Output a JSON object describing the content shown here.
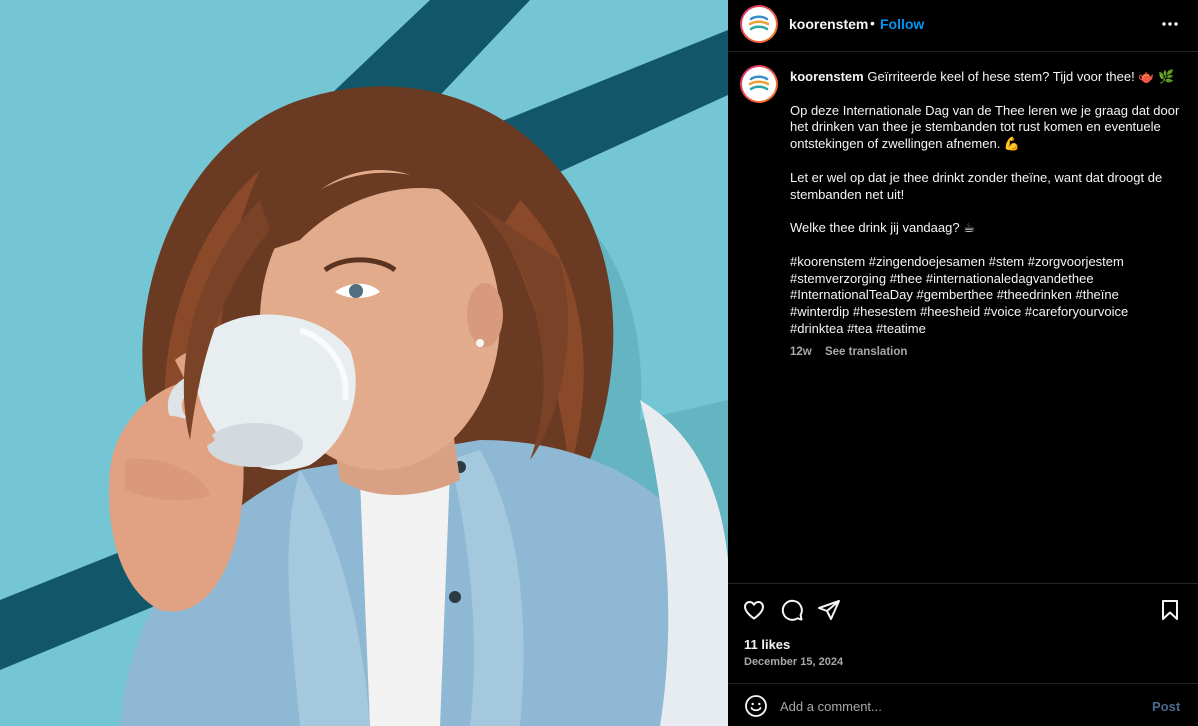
{
  "post": {
    "username": "koorenstem",
    "follow_label": "Follow",
    "separator": "•",
    "more_icon": "more-horizontal-icon"
  },
  "caption": {
    "username": "koorenstem",
    "headline": "Geïrriteerde keel of hese stem? Tijd voor thee! 🫖 🌿",
    "para1": "Op deze Internationale Dag van de Thee leren we je graag dat door het drinken van thee je stembanden tot rust komen en eventuele ontstekingen of zwellingen afnemen. 💪",
    "para2": "Let er wel op dat je thee drinkt zonder theïne, want dat droogt de stembanden net uit!",
    "para3": "Welke thee drink jij vandaag? ☕",
    "hashtags": "#koorenstem #zingendoejesamen #stem #zorgvoorjestem #stemverzorging #thee #internationaledagvandethee #InternationalTeaDay #gemberthee #theedrinken #theïne #winterdip #hesestem #heesheid #voice #careforyourvoice #drinktea #tea #teatime",
    "age": "12w",
    "see_translation": "See translation"
  },
  "engagement": {
    "likes": "11 likes",
    "date": "December 15, 2024"
  },
  "comment": {
    "placeholder": "Add a comment...",
    "post_label": "Post"
  },
  "colors": {
    "accent": "#0095f6",
    "background": "#000000",
    "photo_background": "#74c6d4",
    "stripe": "#12566a"
  },
  "icons": [
    "heart-icon",
    "comment-icon",
    "share-icon",
    "bookmark-icon",
    "emoji-icon"
  ]
}
